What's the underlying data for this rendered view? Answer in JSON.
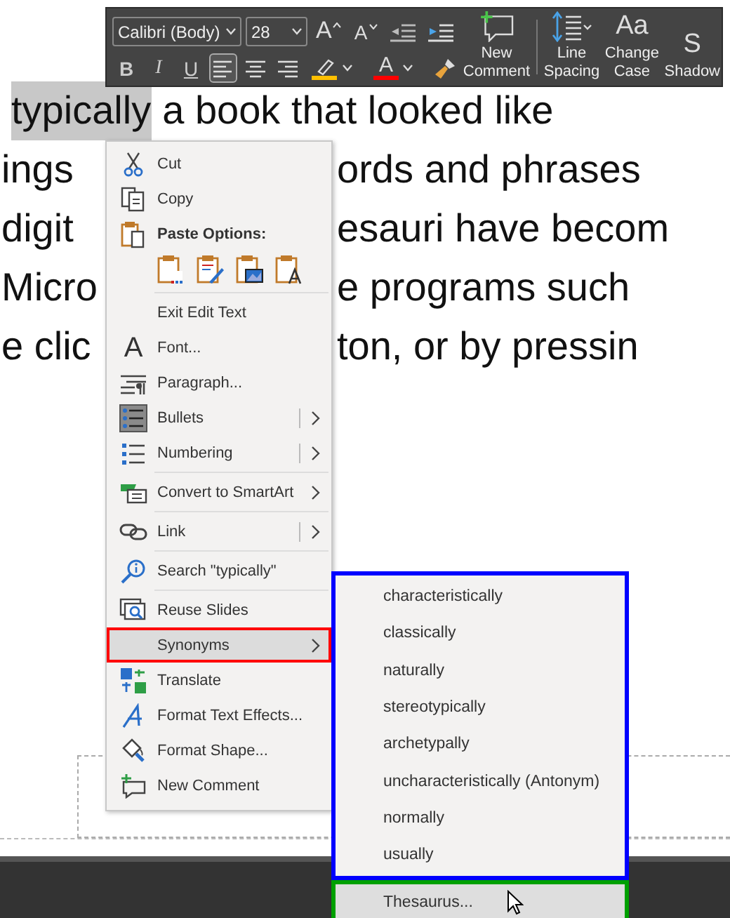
{
  "mini_toolbar": {
    "font": "Calibri (Body)",
    "size": "28",
    "top_tools": [
      {
        "kind": "grow",
        "label": "A"
      },
      {
        "kind": "shrink",
        "label": "A"
      },
      {
        "kind": "outdent"
      },
      {
        "kind": "indent"
      }
    ],
    "format_tools": [
      {
        "kind": "bold",
        "label": "B"
      },
      {
        "kind": "italic",
        "label": "I"
      },
      {
        "kind": "underline",
        "label": "U"
      },
      {
        "kind": "align-left",
        "selected": true
      },
      {
        "kind": "align-center",
        "selected": false
      },
      {
        "kind": "align-right",
        "selected": false
      },
      {
        "kind": "highlight",
        "color": "#ffc000"
      },
      {
        "kind": "font-color",
        "label": "A",
        "color": "#ff0000"
      },
      {
        "kind": "painter"
      }
    ],
    "big_buttons": [
      {
        "kind": "comment",
        "label": "New Comment"
      },
      {
        "kind": "spacing",
        "label": "Line Spacing"
      },
      {
        "kind": "case",
        "label": "Change Case",
        "glyph": "Aa"
      },
      {
        "kind": "shadow",
        "label": "Shadow",
        "glyph": "S"
      }
    ]
  },
  "slide_text": [
    {
      "kind": "full",
      "segments": [
        {
          "text": "typically",
          "selected": true
        },
        {
          "text": "a book that looked like",
          "selected": false
        }
      ]
    },
    {
      "kind": "split",
      "segments": [
        {
          "text": "ings",
          "selected": false
        },
        {
          "text": "ords and phrases",
          "selected": false
        }
      ]
    },
    {
      "kind": "split",
      "segments": [
        {
          "text": "digit",
          "selected": false
        },
        {
          "text": "esauri have becom",
          "selected": false
        }
      ]
    },
    {
      "kind": "split",
      "segments": [
        {
          "text": "Micro",
          "selected": false
        },
        {
          "text": "e programs such",
          "selected": false
        }
      ]
    },
    {
      "kind": "split",
      "segments": [
        {
          "text": "e clic",
          "selected": false
        },
        {
          "text": "ton, or by pressin",
          "selected": false
        }
      ]
    }
  ],
  "context_menu": {
    "items": [
      {
        "kind": "item",
        "label": "Cut",
        "submenu": false,
        "split": false,
        "selected": false
      },
      {
        "kind": "item",
        "label": "Copy",
        "submenu": false,
        "split": false,
        "selected": false
      },
      {
        "kind": "header",
        "label": "Paste Options:"
      },
      {
        "kind": "paste-row"
      },
      {
        "kind": "separator"
      },
      {
        "kind": "item",
        "label": "Exit Edit Text",
        "submenu": false,
        "split": false,
        "selected": false
      },
      {
        "kind": "item",
        "label": "Font...",
        "glyph": "A",
        "submenu": false,
        "split": false,
        "selected": false
      },
      {
        "kind": "item",
        "label": "Paragraph...",
        "submenu": false,
        "split": false,
        "selected": false
      },
      {
        "kind": "item",
        "label": "Bullets",
        "submenu": true,
        "split": true,
        "selected": false
      },
      {
        "kind": "item",
        "label": "Numbering",
        "submenu": true,
        "split": true,
        "selected": false
      },
      {
        "kind": "separator"
      },
      {
        "kind": "item",
        "label": "Convert to SmartArt",
        "submenu": true,
        "split": false,
        "selected": false
      },
      {
        "kind": "separator"
      },
      {
        "kind": "item",
        "label": "Link",
        "submenu": true,
        "split": true,
        "selected": false
      },
      {
        "kind": "separator"
      },
      {
        "kind": "item",
        "label": "Search \"typically\"",
        "submenu": false,
        "split": false,
        "selected": false
      },
      {
        "kind": "separator"
      },
      {
        "kind": "item",
        "label": "Reuse Slides",
        "submenu": false,
        "split": false,
        "selected": false
      },
      {
        "kind": "item",
        "label": "Synonyms",
        "submenu": true,
        "split": false,
        "selected": true,
        "color": "#ff0000"
      },
      {
        "kind": "item",
        "label": "Translate",
        "submenu": false,
        "split": false,
        "selected": false
      },
      {
        "kind": "item",
        "label": "Format Text Effects...",
        "submenu": false,
        "split": false,
        "selected": false
      },
      {
        "kind": "item",
        "label": "Format Shape...",
        "submenu": false,
        "split": false,
        "selected": false
      },
      {
        "kind": "item",
        "label": "New Comment",
        "submenu": false,
        "split": false,
        "selected": false
      }
    ]
  },
  "synonyms_menu": {
    "color": "#0000ff",
    "items": [
      {
        "label": "characteristically"
      },
      {
        "label": "classically"
      },
      {
        "label": "naturally"
      },
      {
        "label": "stereotypically"
      },
      {
        "label": "archetypally"
      },
      {
        "label": "uncharacteristically (Antonym)"
      },
      {
        "label": "normally"
      },
      {
        "label": "usually"
      }
    ],
    "thesaurus": {
      "label": "Thesaurus...",
      "selected": true,
      "color": "#00a000"
    }
  }
}
